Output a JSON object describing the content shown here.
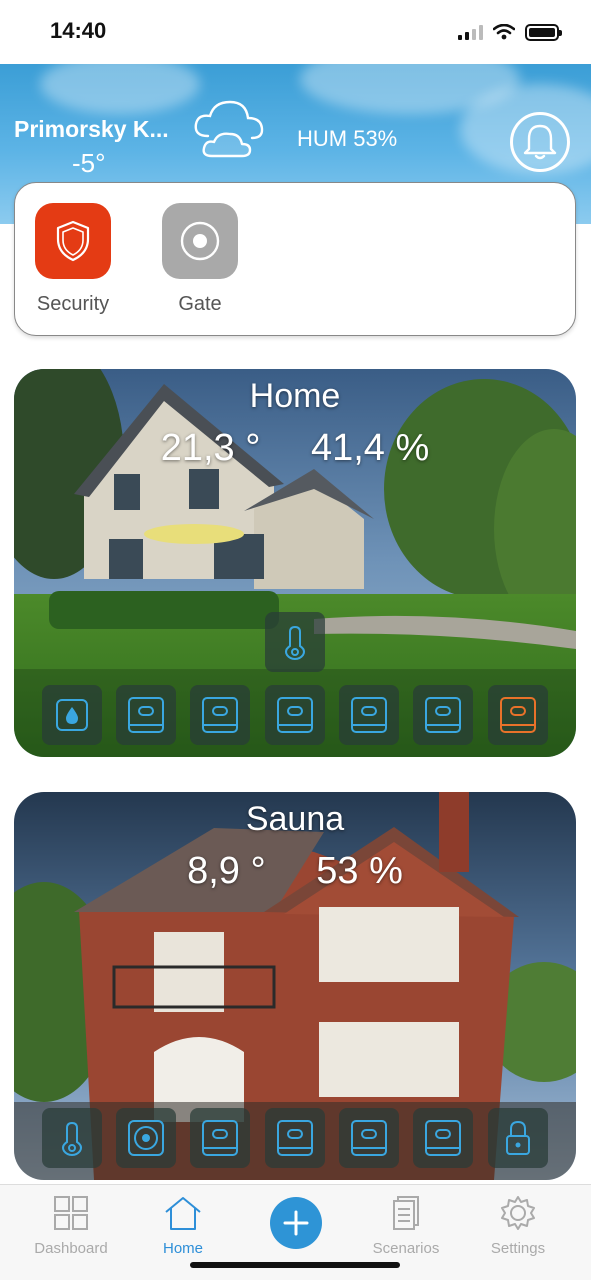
{
  "status_bar": {
    "time": "14:40"
  },
  "header": {
    "location": "Primorsky K...",
    "temperature": "-5°",
    "weather_icon": "cloud-icon",
    "humidity": "HUM 53%"
  },
  "quick_actions": [
    {
      "label": "Security",
      "icon": "shield-icon",
      "color": "#e43b14"
    },
    {
      "label": "Gate",
      "icon": "gate-icon",
      "color": "#a9a9a9"
    }
  ],
  "locations": [
    {
      "title": "Home",
      "temperature": "21,3 °",
      "humidity": "41,4 %"
    },
    {
      "title": "Sauna",
      "temperature": "8,9 °",
      "humidity": "53 %"
    }
  ],
  "nav": {
    "items": [
      {
        "label": "Dashboard",
        "icon": "dashboard-icon"
      },
      {
        "label": "Home",
        "icon": "home-icon"
      },
      {
        "label": "Scenarios",
        "icon": "scenarios-icon"
      },
      {
        "label": "Settings",
        "icon": "settings-icon"
      }
    ],
    "active": "Home",
    "add_icon": "plus-icon"
  },
  "colors": {
    "accent": "#2e8fd8",
    "device_icon": "#3aa7e0",
    "alert_device": "#e8722a"
  }
}
